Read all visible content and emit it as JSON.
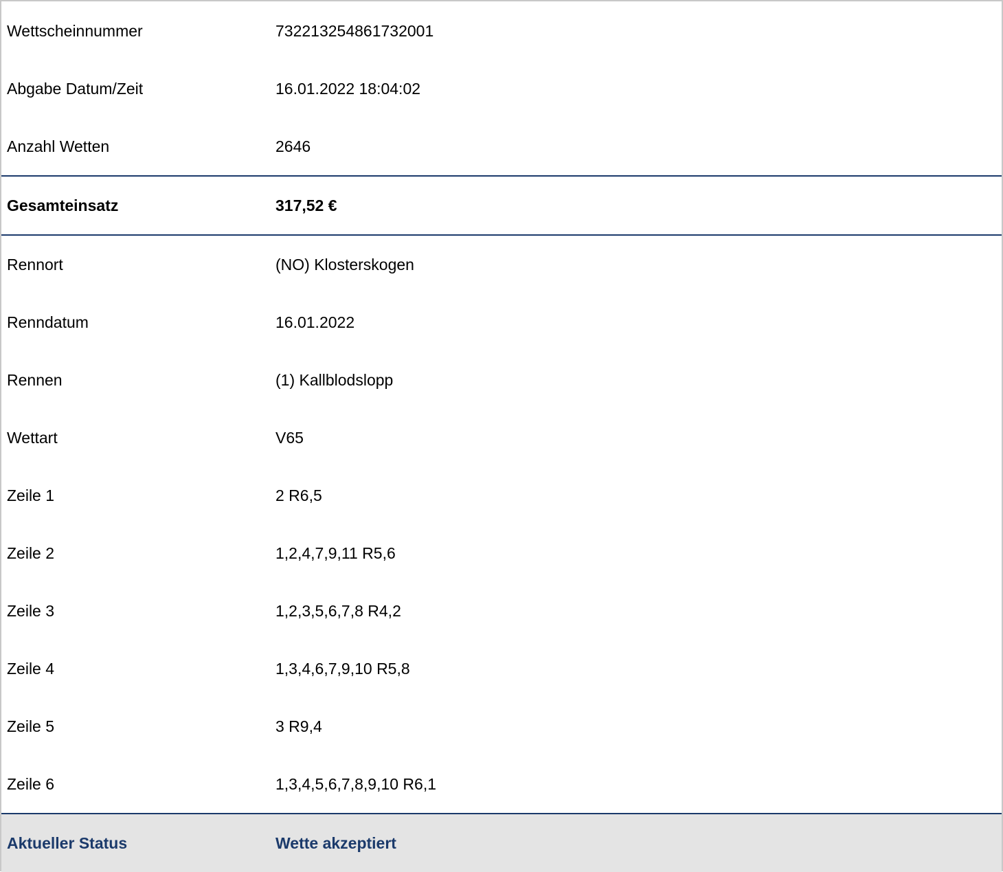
{
  "ticket": {
    "rows": [
      {
        "label": "Wettscheinnummer",
        "value": "732213254861732001"
      },
      {
        "label": "Abgabe Datum/Zeit",
        "value": "16.01.2022 18:04:02"
      },
      {
        "label": "Anzahl Wetten",
        "value": "2646"
      }
    ]
  },
  "total": {
    "label": "Gesamteinsatz",
    "value": "317,52 €"
  },
  "race": {
    "rows": [
      {
        "label": "Rennort",
        "value": "(NO) Klosterskogen"
      },
      {
        "label": "Renndatum",
        "value": "16.01.2022"
      },
      {
        "label": "Rennen",
        "value": "(1) Kallblodslopp"
      },
      {
        "label": "Wettart",
        "value": "V65"
      },
      {
        "label": "Zeile 1",
        "value": "2 R6,5"
      },
      {
        "label": "Zeile 2",
        "value": "1,2,4,7,9,11 R5,6"
      },
      {
        "label": "Zeile 3",
        "value": "1,2,3,5,6,7,8 R4,2"
      },
      {
        "label": "Zeile 4",
        "value": "1,3,4,6,7,9,10 R5,8"
      },
      {
        "label": "Zeile 5",
        "value": "3 R9,4"
      },
      {
        "label": "Zeile 6",
        "value": "1,3,4,5,6,7,8,9,10 R6,1"
      }
    ]
  },
  "status": {
    "label": "Aktueller Status",
    "value": "Wette akzeptiert"
  },
  "colors": {
    "accent": "#1b3a6b",
    "status_bg": "#e4e4e4",
    "frame_border": "#c8c8c8"
  }
}
